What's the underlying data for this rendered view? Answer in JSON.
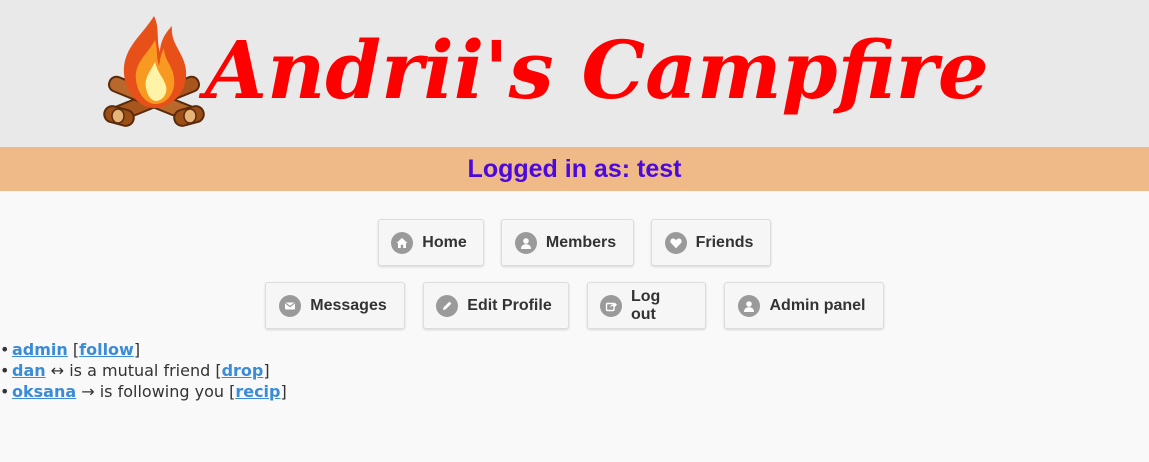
{
  "header": {
    "title": "Andrii's Campfire",
    "logo_icon": "campfire-icon",
    "title_color": "#ff0000",
    "background": "#e9e9e9"
  },
  "status": {
    "text": "Logged in as: test",
    "text_color": "#4b09e0",
    "background": "#efb988"
  },
  "nav": {
    "row1": [
      {
        "label": "Home",
        "icon": "home-icon"
      },
      {
        "label": "Members",
        "icon": "user-icon"
      },
      {
        "label": "Friends",
        "icon": "heart-icon"
      }
    ],
    "row2": [
      {
        "label": "Messages",
        "icon": "mail-icon"
      },
      {
        "label": "Edit Profile",
        "icon": "pencil-icon"
      },
      {
        "label": "Log out",
        "icon": "share-icon"
      },
      {
        "label": "Admin panel",
        "icon": "user-icon"
      }
    ]
  },
  "members": [
    {
      "bullet": "•",
      "name": "admin",
      "relation": "",
      "open": " [",
      "action": "follow",
      "close": "]"
    },
    {
      "bullet": "•",
      "name": "dan",
      "relation": " ↔ is a mutual friend",
      "open": " [",
      "action": "drop",
      "close": "]"
    },
    {
      "bullet": "•",
      "name": "oksana",
      "relation": " → is following you",
      "open": " [",
      "action": "recip",
      "close": "]"
    }
  ],
  "link_color": "#3a8bd8"
}
